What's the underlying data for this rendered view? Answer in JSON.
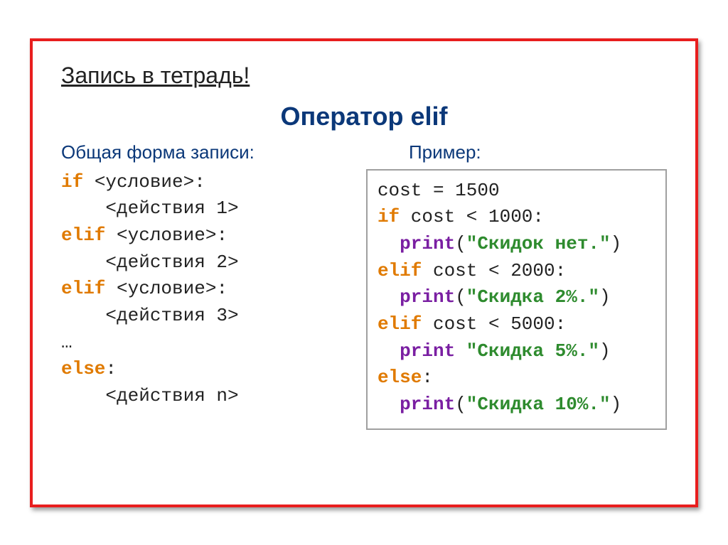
{
  "note_title": "Запись в тетрадь!",
  "main_title": "Оператор elif",
  "left": {
    "subheading": "Общая форма записи:",
    "code": {
      "l1_kw": "if",
      "l1_rest": " <условие>:",
      "l2": "    <действия 1>",
      "l3_kw": "elif",
      "l3_rest": " <условие>:",
      "l4": "    <действия 2>",
      "l5_kw": "elif",
      "l5_rest": " <условие>:",
      "l6": "    <действия 3>",
      "l7": "…",
      "l8_kw": "else",
      "l8_rest": ":",
      "l9": "    <действия n>"
    }
  },
  "right": {
    "subheading": "Пример:",
    "code": {
      "l1": "cost = 1500",
      "l2_kw": "if",
      "l2_rest": " cost < 1000:",
      "l3_indent": "  ",
      "l3_fn": "print",
      "l3_paren": "(",
      "l3_str": "\"Скидок нет.\"",
      "l3_close": ")",
      "l4_kw": "elif",
      "l4_rest": " cost < 2000:",
      "l5_indent": "  ",
      "l5_fn": "print",
      "l5_paren": "(",
      "l5_str": "\"Скидка 2%.\"",
      "l5_close": ")",
      "l6_kw": "elif",
      "l6_rest": " cost < 5000:",
      "l7_indent": "  ",
      "l7_fn": "print",
      "l7_space": " ",
      "l7_str": "\"Скидка 5%.\"",
      "l7_close": ")",
      "l8_kw": "else",
      "l8_rest": ":",
      "l9_indent": "  ",
      "l9_fn": "print",
      "l9_paren": "(",
      "l9_str": "\"Скидка 10%.\"",
      "l9_close": ")"
    }
  }
}
